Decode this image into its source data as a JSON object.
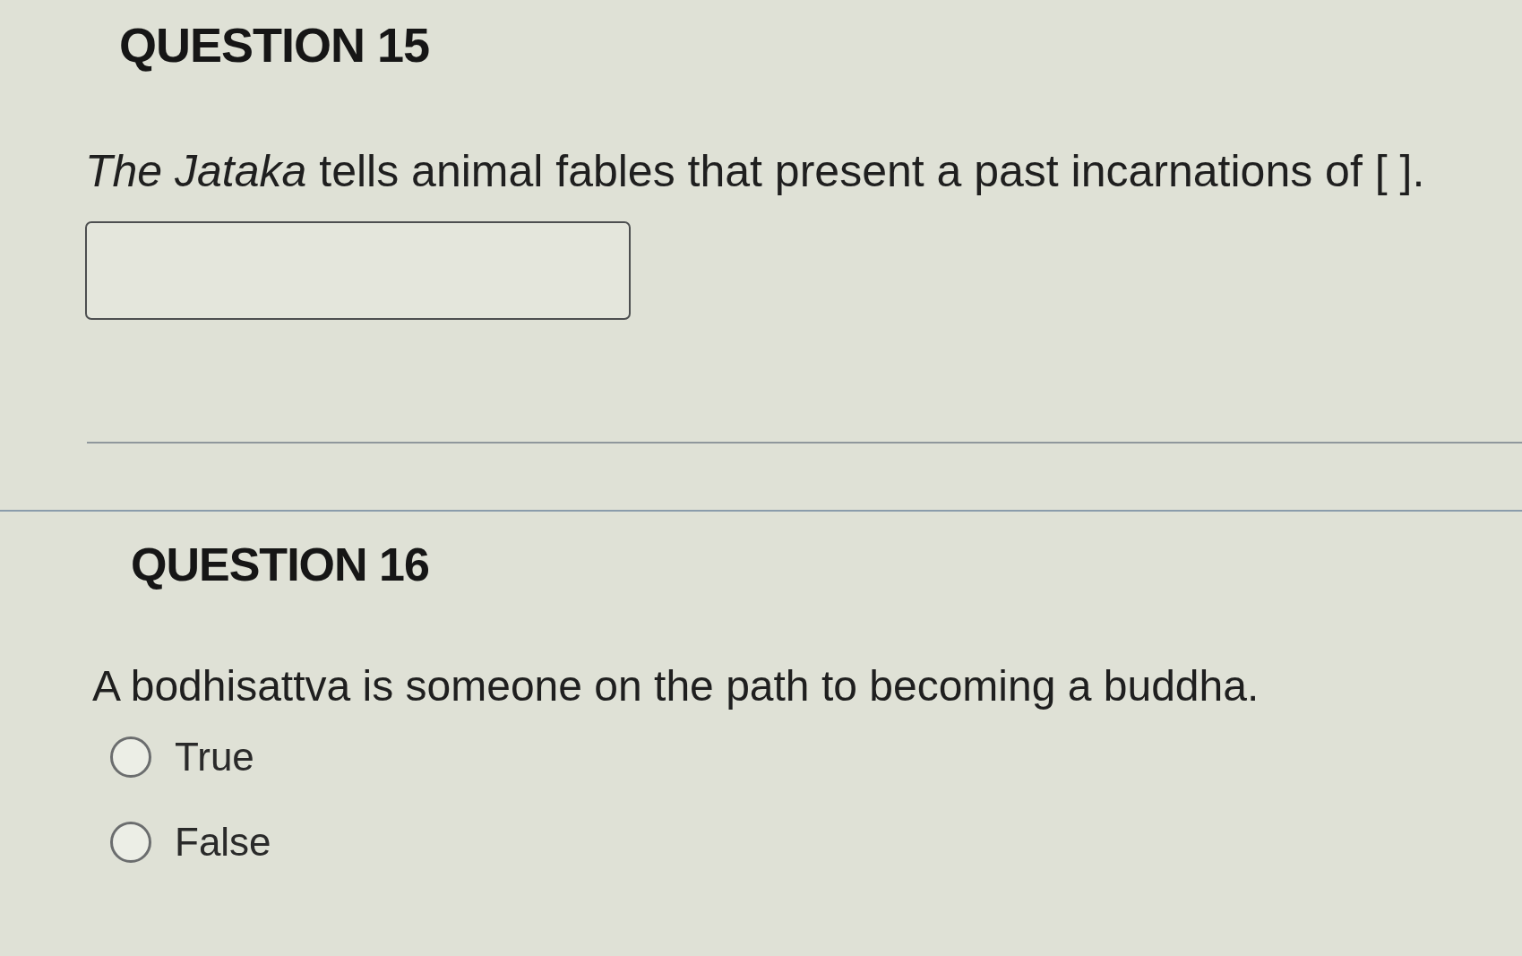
{
  "questions": [
    {
      "kind": "fill_in",
      "heading": "QUESTION 15",
      "prompt": "*The Jataka* tells animal fables that present a past incarnations of [ ]."
    },
    {
      "kind": "true_false",
      "heading": "QUESTION 16",
      "prompt": "A bodhisattva is someone on the path to becoming a buddha.",
      "options": [
        {
          "label": "True",
          "selected": false
        },
        {
          "label": "False",
          "selected": false
        }
      ]
    }
  ]
}
